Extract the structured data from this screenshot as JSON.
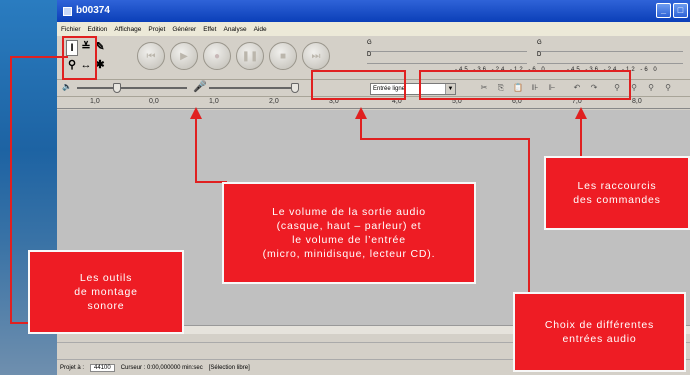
{
  "window": {
    "title": "b00374"
  },
  "menu": [
    "Fichier",
    "Edition",
    "Affichage",
    "Projet",
    "Générer",
    "Effet",
    "Analyse",
    "Aide"
  ],
  "meters": {
    "left_labels": [
      "G",
      "D"
    ],
    "scale_play": "-45  -36  -24  -12 -6 0",
    "scale_rec": "-45  -36  -24  -12 -6 0"
  },
  "input_source": {
    "selected": "Entrée ligne"
  },
  "ruler_ticks": [
    "1,0",
    "0,0",
    "1,0",
    "2,0",
    "3,0",
    "4,0",
    "5,0",
    "6,0",
    "7,0",
    "8,0",
    "9,0"
  ],
  "status": {
    "rate_label": "Projet à :",
    "rate_value": "44100",
    "cursor": "Curseur : 0:00,000000 min:sec",
    "selection": "[Sélection libre]"
  },
  "callouts": {
    "tools": "Les outils\nde montage\nsonore",
    "volume": "Le volume de la sortie audio\n(casque, haut – parleur) et\nle volume de l’entrée\n(micro, minidisque, lecteur CD).",
    "shortcuts": "Les raccourcis\ndes commandes",
    "inputs": "Choix de différentes\nentrées audio"
  },
  "colors": {
    "annotation_red": "#ee1c24",
    "titlebar_blue": "#0b3fb8"
  }
}
